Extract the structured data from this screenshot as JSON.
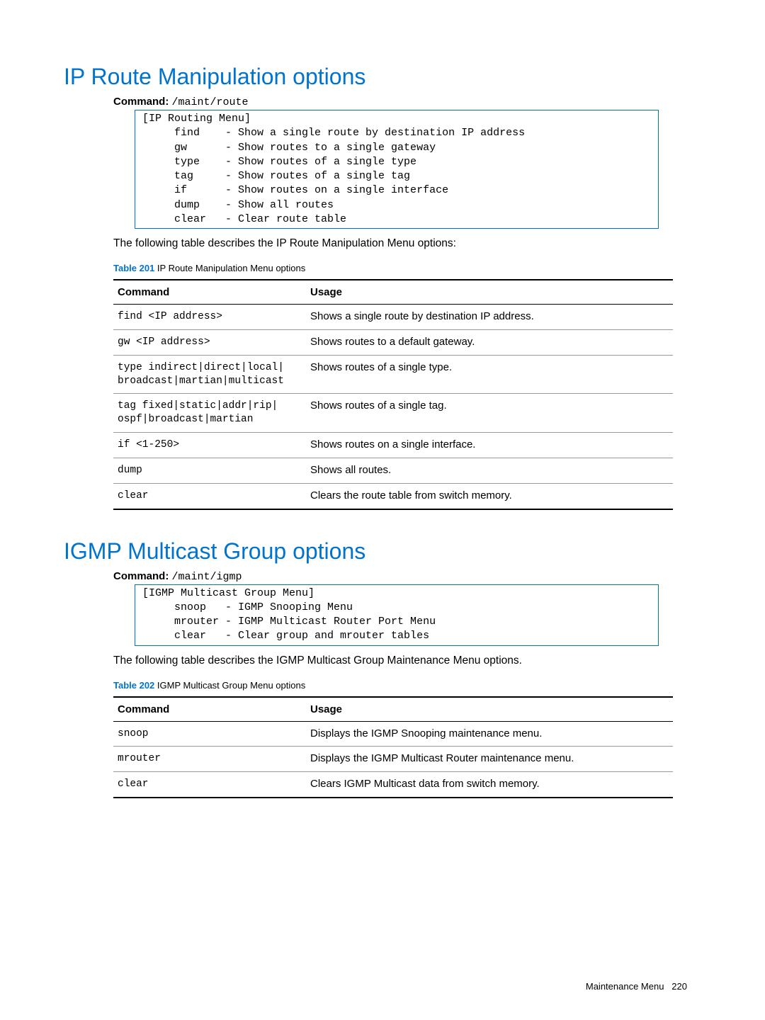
{
  "section1": {
    "title": "IP Route Manipulation options",
    "command_label": "Command:",
    "command_path": "/maint/route",
    "menu": "[IP Routing Menu]\n     find    - Show a single route by destination IP address\n     gw      - Show routes to a single gateway\n     type    - Show routes of a single type\n     tag     - Show routes of a single tag\n     if      - Show routes on a single interface\n     dump    - Show all routes\n     clear   - Clear route table",
    "description": "The following table describes the IP Route Manipulation Menu options:",
    "table_caption_num": "Table 201",
    "table_caption_text": " IP Route Manipulation Menu options",
    "headers": {
      "c1": "Command",
      "c2": "Usage"
    },
    "rows": [
      {
        "cmd": "find <IP address>",
        "usage": "Shows a single route by destination IP address."
      },
      {
        "cmd": "gw <IP address>",
        "usage": "Shows routes to a default gateway."
      },
      {
        "cmd": "type indirect|direct|local|\nbroadcast|martian|multicast",
        "usage": "Shows routes of a single type."
      },
      {
        "cmd": "tag fixed|static|addr|rip|\nospf|broadcast|martian",
        "usage": "Shows routes of a single tag."
      },
      {
        "cmd": "if <1-250>",
        "usage": "Shows routes on a single interface."
      },
      {
        "cmd": "dump",
        "usage": "Shows all routes."
      },
      {
        "cmd": "clear",
        "usage": "Clears the route table from switch memory."
      }
    ]
  },
  "section2": {
    "title": "IGMP Multicast Group options",
    "command_label": "Command:",
    "command_path": "/maint/igmp",
    "menu": "[IGMP Multicast Group Menu]\n     snoop   - IGMP Snooping Menu\n     mrouter - IGMP Multicast Router Port Menu\n     clear   - Clear group and mrouter tables",
    "description": "The following table describes the IGMP Multicast Group Maintenance Menu options.",
    "table_caption_num": "Table 202",
    "table_caption_text": " IGMP Multicast Group Menu options",
    "headers": {
      "c1": "Command",
      "c2": "Usage"
    },
    "rows": [
      {
        "cmd": "snoop",
        "usage": "Displays the IGMP Snooping maintenance menu."
      },
      {
        "cmd": "mrouter",
        "usage": "Displays the IGMP Multicast Router maintenance menu."
      },
      {
        "cmd": "clear",
        "usage": "Clears IGMP Multicast data from switch memory."
      }
    ]
  },
  "footer": {
    "text": "Maintenance Menu",
    "page": "220"
  }
}
